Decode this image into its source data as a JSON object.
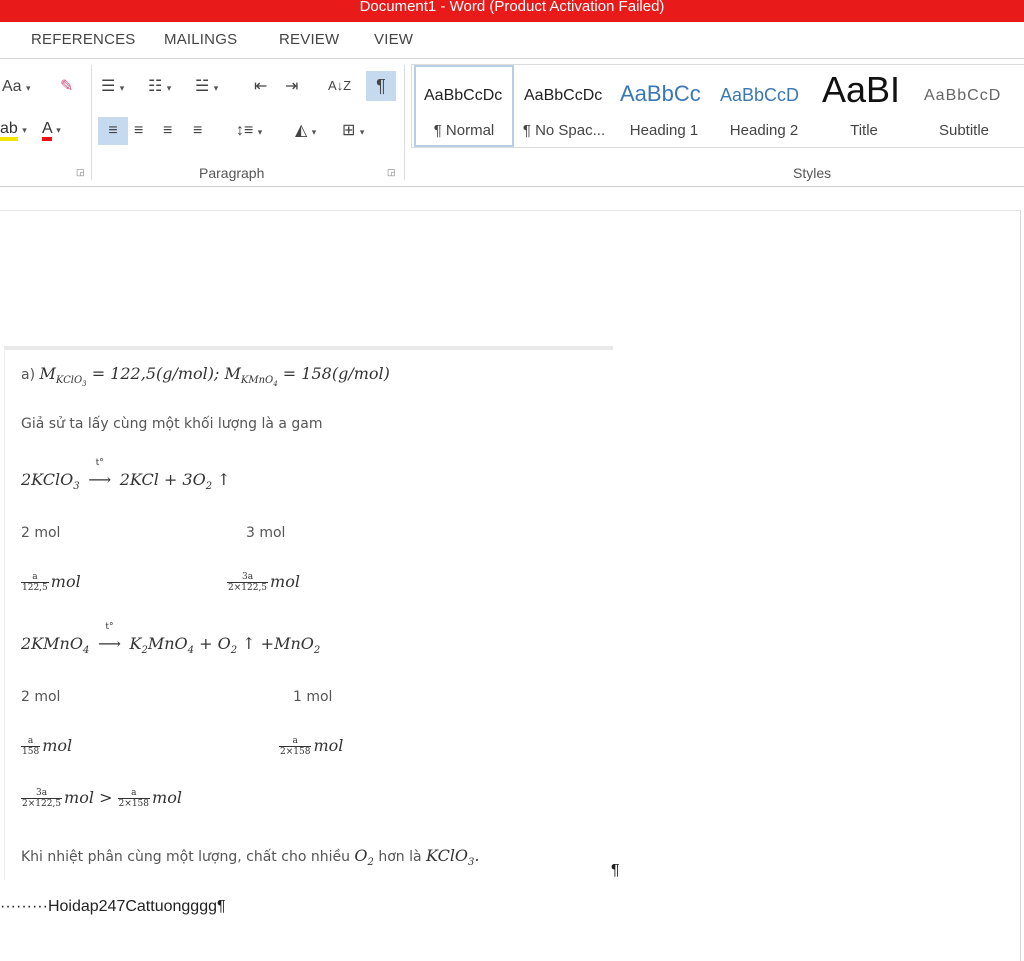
{
  "window": {
    "title": "Document1 - Word (Product Activation Failed)"
  },
  "tabs": [
    "REFERENCES",
    "MAILINGS",
    "REVIEW",
    "VIEW"
  ],
  "ribbon": {
    "font_group": {
      "font_size_btn": "Aa",
      "font_color_btn": "A"
    },
    "paragraph_group": {
      "label": "Paragraph",
      "sort_btn": "A↓Z",
      "pilcrow_btn": "¶"
    },
    "styles_group": {
      "label": "Styles",
      "items": [
        {
          "sample": "AaBbCcDc",
          "name": "¶ Normal"
        },
        {
          "sample": "AaBbCcDc",
          "name": "¶ No Spac..."
        },
        {
          "sample": "AaBbCc",
          "name": "Heading 1"
        },
        {
          "sample": "AaBbCcD",
          "name": "Heading 2"
        },
        {
          "sample": "AaBI",
          "name": "Title"
        },
        {
          "sample": "AaBbCcD",
          "name": "Subtitle"
        }
      ]
    }
  },
  "document": {
    "line1": {
      "prefix": "a)",
      "eq": "M_KClO3 = 122,5(g/mol); M_KMnO4 = 158(g/mol)"
    },
    "line2": "Giả sử ta lấy cùng một khối lượng là a gam",
    "reaction1": {
      "left": "2KClO3",
      "arrow_label": "t°",
      "right": "2KCl + 3O2 ↑"
    },
    "r1_moles": {
      "left": "2 mol",
      "right": "3 mol"
    },
    "r1_fracs": {
      "left_num": "a",
      "left_den": "122,5",
      "right_num": "3a",
      "right_den": "2×122,5",
      "unit": "mol"
    },
    "reaction2": {
      "left": "2KMnO4",
      "arrow_label": "t°",
      "right": "K2MnO4 + O2 ↑ +MnO2"
    },
    "r2_moles": {
      "left": "2 mol",
      "right": "1 mol"
    },
    "r2_fracs": {
      "left_num": "a",
      "left_den": "158",
      "right_num": "a",
      "right_den": "2×158",
      "unit": "mol"
    },
    "compare": {
      "a_num": "3a",
      "a_den": "2×122,5",
      "b_num": "a",
      "b_den": "2×158",
      "op": ">",
      "unit": "mol"
    },
    "conclusion": {
      "text": "Khi nhiệt phân cùng một lượng, chất cho nhiều",
      "o2": "O2",
      "mid": "hơn là",
      "kclo3": "KClO3."
    },
    "pilcrow": "¶",
    "signature": "·········Hoidap247Cattuongggg¶"
  }
}
